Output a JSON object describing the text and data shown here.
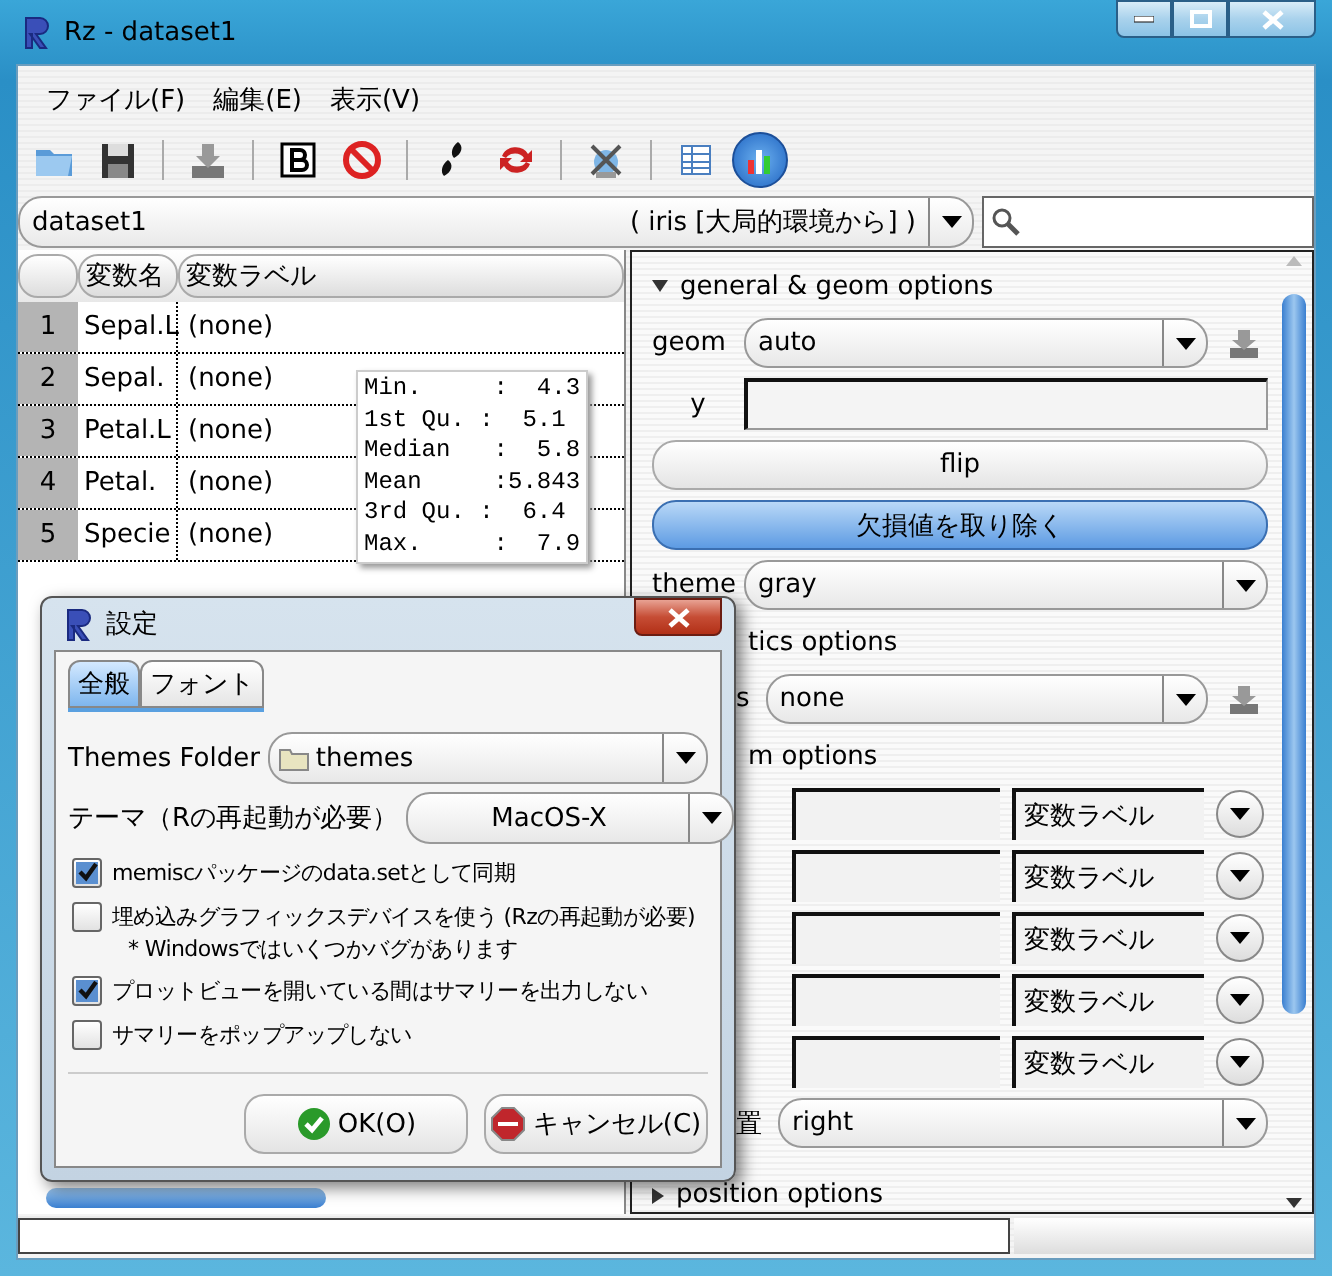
{
  "window": {
    "title": "Rz - dataset1"
  },
  "menu": [
    "ファイル(F)",
    "編集(E)",
    "表示(V)"
  ],
  "toolbar": [
    {
      "kind": "open",
      "pressed": false
    },
    {
      "kind": "save",
      "pressed": false
    },
    {
      "kind": "separator"
    },
    {
      "kind": "import",
      "pressed": false
    },
    {
      "kind": "separator"
    },
    {
      "kind": "bold",
      "pressed": false
    },
    {
      "kind": "stop",
      "pressed": false
    },
    {
      "kind": "separator"
    },
    {
      "kind": "script",
      "pressed": false
    },
    {
      "kind": "refresh",
      "pressed": false
    },
    {
      "kind": "separator"
    },
    {
      "kind": "tools",
      "pressed": false
    },
    {
      "kind": "separator"
    },
    {
      "kind": "table",
      "pressed": false
    },
    {
      "kind": "chart",
      "pressed": true
    }
  ],
  "dataset": {
    "value": "dataset1",
    "source": "( iris [大局的環境から] )"
  },
  "variables": {
    "columns": [
      "変数名",
      "変数ラベル"
    ],
    "rows": [
      {
        "number": "1",
        "name": "Sepal.L",
        "label": "(none)"
      },
      {
        "number": "2",
        "name": "Sepal.",
        "label": "(none)"
      },
      {
        "number": "3",
        "name": "Petal.L",
        "label": "(none)"
      },
      {
        "number": "4",
        "name": "Petal.",
        "label": "(none)"
      },
      {
        "number": "5",
        "name": "Specie",
        "label": "(none)"
      }
    ]
  },
  "summary_tooltip": [
    "Min.     :  4.3",
    "1st Qu. :  5.1",
    "Median   :  5.8",
    "Mean     :5.843",
    "3rd Qu. :  6.4",
    "Max.     :  7.9"
  ],
  "plot_options": [
    {
      "kind": "section",
      "label": "general & geom options",
      "expanded": true
    },
    {
      "kind": "combo",
      "label": "geom",
      "value": "auto",
      "import_button": true
    },
    {
      "kind": "field",
      "label": "y"
    },
    {
      "kind": "button",
      "label": "flip",
      "pressed": false
    },
    {
      "kind": "button",
      "label": "欠損値を取り除く",
      "pressed": true
    },
    {
      "kind": "combo",
      "label": "theme",
      "value": "gray",
      "import_button": false
    },
    {
      "kind": "section_cut",
      "label": "tics options"
    },
    {
      "kind": "combo_cut",
      "label": "s",
      "value": "none",
      "import_button": true
    },
    {
      "kind": "section_cut",
      "label": "m options"
    },
    {
      "kind": "mapping",
      "value": "変数ラベル"
    },
    {
      "kind": "mapping",
      "value": "変数ラベル"
    },
    {
      "kind": "mapping",
      "value": "変数ラベル"
    },
    {
      "kind": "mapping",
      "value": "変数ラベル"
    },
    {
      "kind": "mapping",
      "value": "変数ラベル"
    },
    {
      "kind": "combo_cut",
      "label": "置",
      "value": "right",
      "import_button": false
    },
    {
      "kind": "section",
      "label": "position options",
      "expanded": false
    }
  ],
  "dialog": {
    "title": "設定",
    "tabs": [
      {
        "label": "全般",
        "selected": true
      },
      {
        "label": "フォント",
        "selected": false
      }
    ],
    "themes_folder": {
      "label": "Themes Folder",
      "value": "themes"
    },
    "theme": {
      "label": "テーマ（Rの再起動が必要）",
      "value": "MacOS-X"
    },
    "options": [
      {
        "label": "memiscパッケージのdata.setとして同期",
        "checked": true
      },
      {
        "label": "埋め込みグラフィックスデバイスを使う (Rzの再起動が必要)",
        "note": "* Windowsではいくつかバグがあります",
        "checked": false
      },
      {
        "label": "プロットビューを開いている間はサマリーを出力しない",
        "checked": true
      },
      {
        "label": "サマリーをポップアップしない",
        "checked": false
      }
    ],
    "buttons": [
      {
        "kind": "ok",
        "label": "OK(O)"
      },
      {
        "kind": "cancel",
        "label": "キャンセル(C)"
      }
    ]
  }
}
